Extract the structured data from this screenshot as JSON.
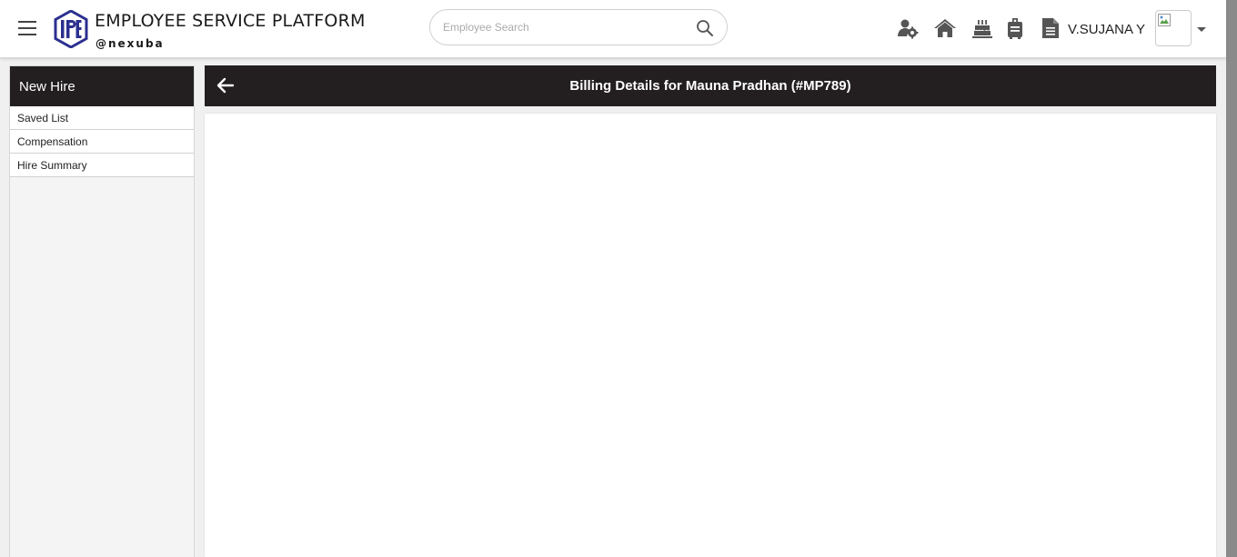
{
  "header": {
    "title": "EMPLOYEE SERVICE PLATFORM",
    "subtitle": "@nexuba",
    "logo_icon": "ipe-logo-icon",
    "search": {
      "placeholder": "Employee Search",
      "value": ""
    },
    "icons": [
      "people-settings-icon",
      "home-icon",
      "birthday-cake-icon",
      "luggage-icon",
      "document-icon"
    ],
    "username": "V.SUJANA Y"
  },
  "sidebar": {
    "heading": "New Hire",
    "items": [
      {
        "label": "Saved List"
      },
      {
        "label": "Compensation"
      },
      {
        "label": "Hire Summary"
      }
    ]
  },
  "main": {
    "title": "Billing Details for Mauna Pradhan (#MP789)"
  },
  "colors": {
    "dark_bar": "#231f20",
    "logo_blue": "#2b2f8f",
    "page_bg": "#f0f0f0"
  }
}
